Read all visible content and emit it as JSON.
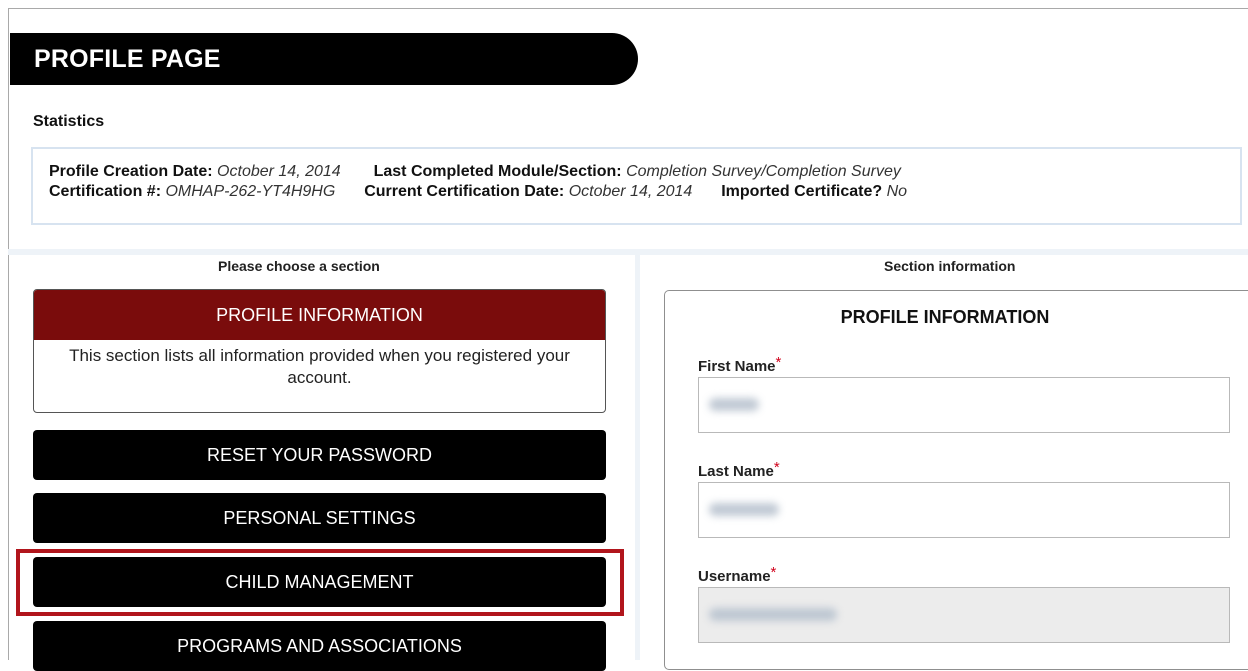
{
  "page": {
    "title": "PROFILE PAGE"
  },
  "stats": {
    "heading": "Statistics",
    "creation_label": "Profile Creation Date:",
    "creation_value": "October 14, 2014",
    "last_module_label": "Last Completed Module/Section:",
    "last_module_value": "Completion Survey/Completion Survey",
    "cert_label": "Certification #:",
    "cert_value": "OMHAP-262-YT4H9HG",
    "current_cert_label": "Current Certification Date:",
    "current_cert_value": "October 14, 2014",
    "imported_label": "Imported Certificate?",
    "imported_value": "No"
  },
  "left": {
    "heading": "Please choose a section",
    "active_section": {
      "title": "PROFILE INFORMATION",
      "description": "This section lists all information provided when you registered your account."
    },
    "sections": [
      "RESET YOUR PASSWORD",
      "PERSONAL SETTINGS",
      "CHILD MANAGEMENT",
      "PROGRAMS AND ASSOCIATIONS"
    ]
  },
  "right": {
    "heading": "Section information",
    "panel_title": "PROFILE INFORMATION",
    "required_mark": "*",
    "fields": [
      {
        "label": "First Name"
      },
      {
        "label": "Last Name"
      },
      {
        "label": "Username"
      }
    ]
  },
  "colors": {
    "active_section_bg": "#7a0c0c",
    "highlight_border": "#b1151c",
    "required": "#d0021b"
  }
}
